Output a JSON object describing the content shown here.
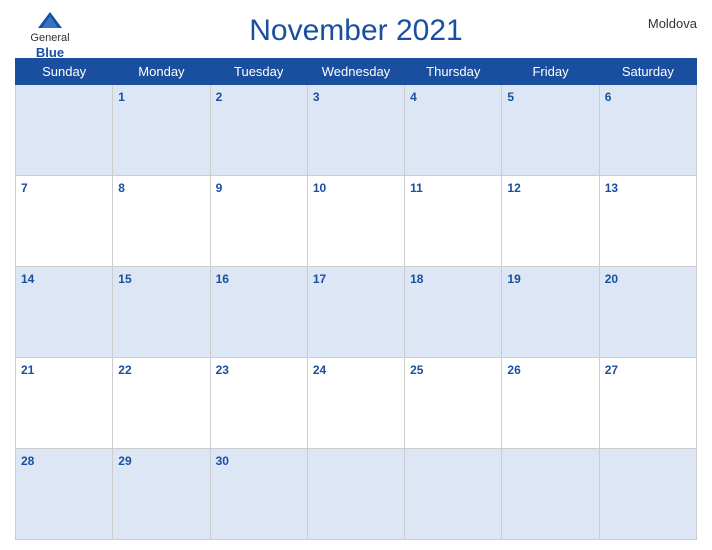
{
  "header": {
    "logo": {
      "general": "General",
      "blue": "Blue",
      "icon_shape": "triangle"
    },
    "title": "November 2021",
    "country": "Moldova"
  },
  "calendar": {
    "days_of_week": [
      "Sunday",
      "Monday",
      "Tuesday",
      "Wednesday",
      "Thursday",
      "Friday",
      "Saturday"
    ],
    "weeks": [
      [
        null,
        1,
        2,
        3,
        4,
        5,
        6
      ],
      [
        7,
        8,
        9,
        10,
        11,
        12,
        13
      ],
      [
        14,
        15,
        16,
        17,
        18,
        19,
        20
      ],
      [
        21,
        22,
        23,
        24,
        25,
        26,
        27
      ],
      [
        28,
        29,
        30,
        null,
        null,
        null,
        null
      ]
    ]
  }
}
